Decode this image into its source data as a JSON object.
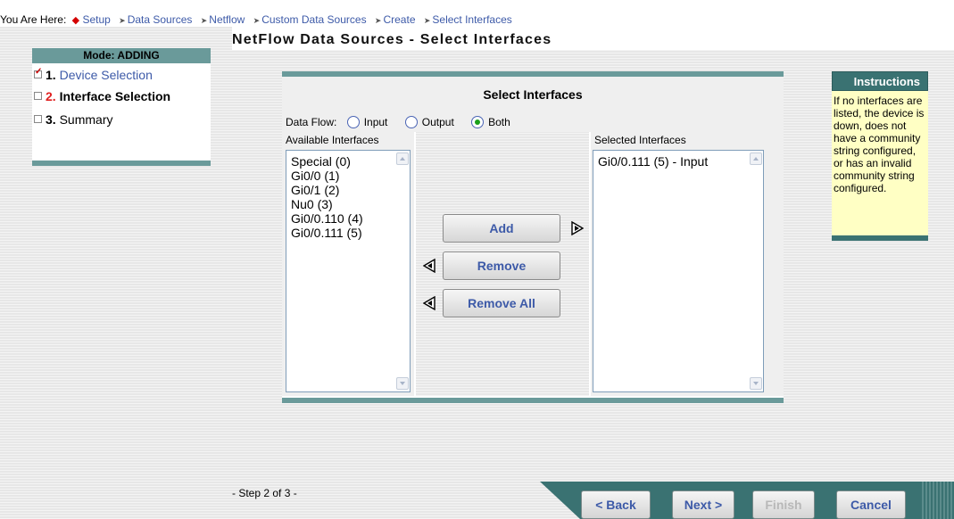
{
  "breadcrumb": {
    "lead": "You Are Here:",
    "items": [
      "Setup",
      "Data Sources",
      "Netflow",
      "Custom Data Sources",
      "Create",
      "Select Interfaces"
    ]
  },
  "sidebar": {
    "mode_title": "Mode: ADDING",
    "steps": [
      {
        "num": "1.",
        "label": "Device Selection"
      },
      {
        "num": "2.",
        "label": "Interface Selection"
      },
      {
        "num": "3.",
        "label": "Summary"
      }
    ]
  },
  "page_title": "NetFlow Data Sources - Select Interfaces",
  "select_panel": {
    "title": "Select Interfaces",
    "data_flow_label": "Data Flow:",
    "radios": [
      {
        "label": "Input",
        "checked": false
      },
      {
        "label": "Output",
        "checked": false
      },
      {
        "label": "Both",
        "checked": true
      }
    ],
    "available_caption": "Available Interfaces",
    "available_items": [
      "Special (0)",
      "Gi0/0 (1)",
      "Gi0/1 (2)",
      "Nu0 (3)",
      "Gi0/0.110 (4)",
      "Gi0/0.111 (5)"
    ],
    "selected_caption": "Selected Interfaces",
    "selected_items": [
      "Gi0/0.111 (5) - Input"
    ],
    "buttons": {
      "add": "Add",
      "remove": "Remove",
      "remove_all": "Remove All"
    }
  },
  "instructions": {
    "title": "Instructions",
    "text": "If no interfaces are listed, the device is down, does not have a community string configured, or has an invalid community string configured."
  },
  "footer": {
    "step_text": "- Step 2 of 3 -",
    "back": "< Back",
    "next": "Next >",
    "finish": "Finish",
    "cancel": "Cancel"
  },
  "colors": {
    "accent_teal": "#6a9a9a",
    "dark_teal": "#3a7272",
    "link_blue": "#3d5aa8",
    "active_red": "#e02020"
  }
}
